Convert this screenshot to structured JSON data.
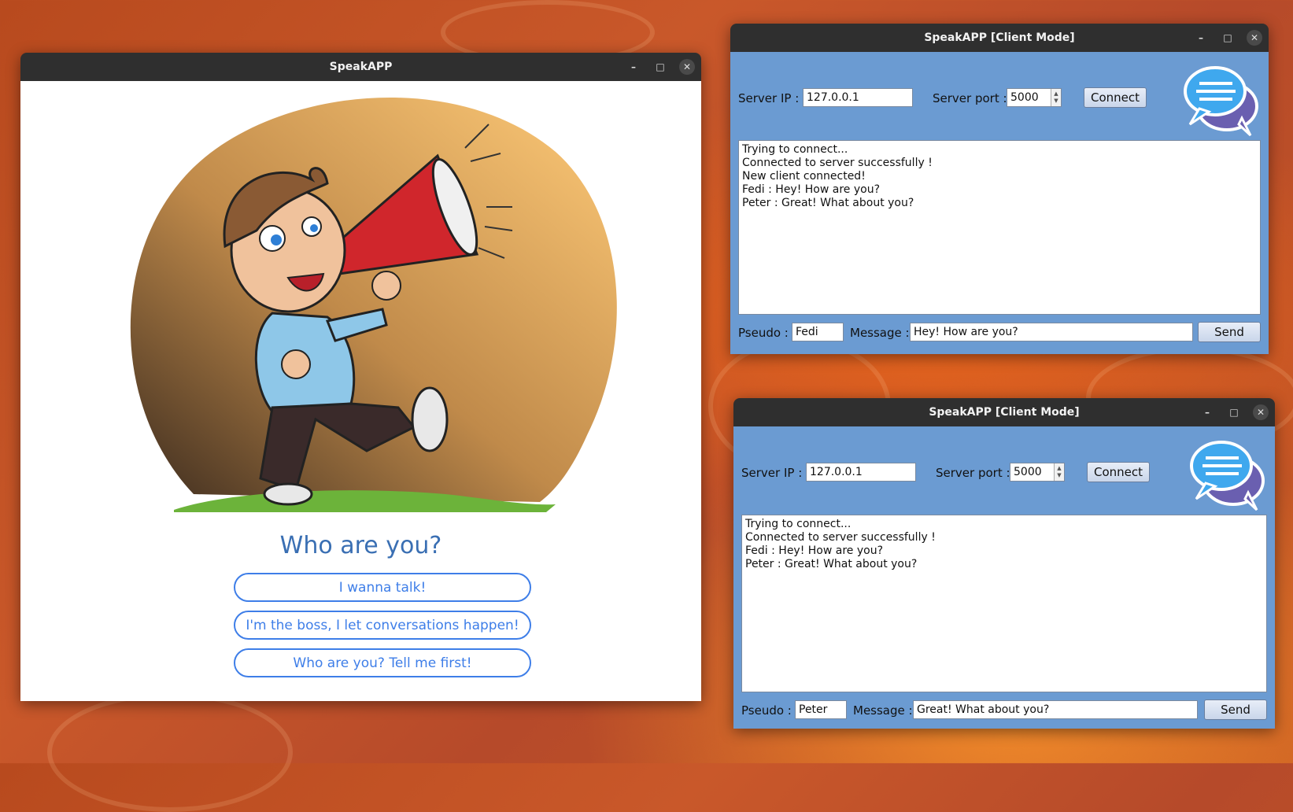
{
  "main_window": {
    "title": "SpeakAPP",
    "question": "Who are you?",
    "choices": [
      {
        "label": "I wanna talk!"
      },
      {
        "label": "I'm the boss, I let conversations happen!"
      },
      {
        "label": "Who are you? Tell me first!"
      }
    ]
  },
  "window_controls": {
    "minimize": "–",
    "maximize": "□",
    "close": "✕"
  },
  "client1": {
    "title": "SpeakAPP [Client Mode]",
    "server_ip_label": "Server IP :",
    "server_ip": "127.0.0.1",
    "server_port_label": "Server port :",
    "server_port": "5000",
    "connect_label": "Connect",
    "log": [
      "Trying to connect...",
      "Connected to server successfully !",
      "New client connected!",
      "Fedi : Hey! How are you?",
      "Peter : Great! What about you?"
    ],
    "pseudo_label": "Pseudo :",
    "pseudo": "Fedi",
    "message_label": "Message :",
    "message": "Hey! How are you?",
    "send_label": "Send"
  },
  "client2": {
    "title": "SpeakAPP [Client Mode]",
    "server_ip_label": "Server IP :",
    "server_ip": "127.0.0.1",
    "server_port_label": "Server port :",
    "server_port": "5000",
    "connect_label": "Connect",
    "log": [
      "Trying to connect...",
      "Connected to server successfully !",
      "Fedi : Hey! How are you?",
      "Peter : Great! What about you?"
    ],
    "pseudo_label": "Pseudo :",
    "pseudo": "Peter",
    "message_label": "Message :",
    "message": "Great! What about you?",
    "send_label": "Send"
  },
  "colors": {
    "accent": "#3e7ee8",
    "client_bg": "#6b9bd2",
    "titlebar": "#2f2f2f",
    "desktop": "#c9582a"
  },
  "icons": {
    "hero_illustration": "boy-megaphone-illustration",
    "chat_logo": "chat-bubbles-icon"
  }
}
